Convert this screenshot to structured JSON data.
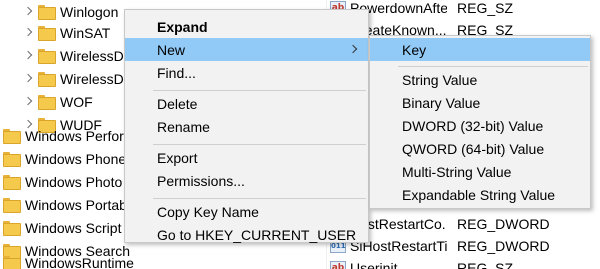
{
  "tree": {
    "items": [
      {
        "label": "Winlogon",
        "selected": true
      },
      {
        "label": "WinSAT"
      },
      {
        "label": "WirelessDi"
      },
      {
        "label": "WirelessDe"
      },
      {
        "label": "WOF"
      },
      {
        "label": "WUDF"
      },
      {
        "label": "Windows Perform"
      },
      {
        "label": "Windows Phone"
      },
      {
        "label": "Windows Photo V"
      },
      {
        "label": "Windows Portabl"
      },
      {
        "label": "Windows Script H"
      },
      {
        "label": "Windows Search"
      },
      {
        "label": "WindowsRuntime"
      }
    ]
  },
  "values": {
    "rows": [
      {
        "name": "PowerdownAfter...",
        "type": "REG_SZ",
        "icon": "ab"
      },
      {
        "name": "CreateKnown...",
        "type": "REG_SZ",
        "icon": "ab"
      },
      {
        "name": "HostRestartCo...",
        "type": "REG_DWORD",
        "icon": "011"
      },
      {
        "name": "SiHostRestartTi...",
        "type": "REG_DWORD",
        "icon": "011"
      },
      {
        "name": "Userinit",
        "type": "REG_SZ",
        "icon": "ab"
      }
    ]
  },
  "context_menu": {
    "items": [
      {
        "label": "Expand",
        "bold": true
      },
      {
        "label": "New",
        "submenu": true,
        "highlighted": true
      },
      {
        "label": "Find..."
      },
      {
        "label": "Delete"
      },
      {
        "label": "Rename"
      },
      {
        "label": "Export"
      },
      {
        "label": "Permissions..."
      },
      {
        "label": "Copy Key Name"
      },
      {
        "label": "Go to HKEY_CURRENT_USER"
      }
    ]
  },
  "submenu": {
    "items": [
      {
        "label": "Key",
        "highlighted": true
      },
      {
        "label": "String Value"
      },
      {
        "label": "Binary Value"
      },
      {
        "label": "DWORD (32-bit) Value"
      },
      {
        "label": "QWORD (64-bit) Value"
      },
      {
        "label": "Multi-String Value"
      },
      {
        "label": "Expandable String Value"
      }
    ]
  },
  "colors": {
    "highlight": "#91c9f7",
    "menu_bg": "#f2f2f2",
    "selected_tree_bg": "#d9d9d9",
    "folder": "#f5c94c"
  }
}
